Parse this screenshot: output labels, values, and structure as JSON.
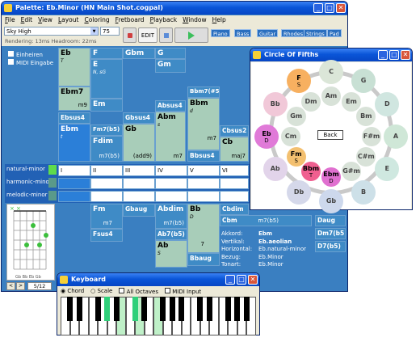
{
  "palette": {
    "title": "Palette: Eb.Minor (HN Main Shot.cogpal)",
    "menu": [
      "File",
      "Edit",
      "View",
      "Layout",
      "Coloring",
      "Fretboard",
      "Playback",
      "Window",
      "Help"
    ],
    "sound": "Sky High",
    "tempo": "75",
    "edit": "EDIT",
    "tabs": [
      "Piano",
      "Bass",
      "Guitar",
      "Rhodes",
      "Strings",
      "Pad"
    ],
    "status": "Rendering: 13ms    Headroom: 22ms",
    "checks": [
      "Einheiren",
      "MIDI Eingabe"
    ],
    "chords": [
      {
        "name": "Eb",
        "sub": "T",
        "cls": "gl"
      },
      {
        "name": "F",
        "sub": "",
        "cls": "gm"
      },
      {
        "name": "Gbm",
        "sub": "",
        "cls": "gm"
      },
      {
        "name": "G",
        "sub": "",
        "cls": "gm"
      },
      {
        "name": "E",
        "sub": "N, sG",
        "cls": "gm"
      },
      {
        "name": "Gm",
        "sub": "",
        "cls": "gm"
      },
      {
        "name": "Ebm7",
        "sub": "",
        "extra": "m9",
        "cls": "gl"
      },
      {
        "name": "Em",
        "sub": "",
        "cls": "gm"
      },
      {
        "name": "Bbm7(#5)",
        "sub": "",
        "cls": "gm"
      },
      {
        "name": "Bbm",
        "sub": "d",
        "extra": "m7",
        "cls": "gl"
      },
      {
        "name": "Absus4",
        "sub": "",
        "cls": "gm"
      },
      {
        "name": "Abm",
        "sub": "s",
        "extra": "m7",
        "cls": "gl"
      },
      {
        "name": "Ebsus4",
        "sub": "",
        "cls": "gm"
      },
      {
        "name": "Ebm",
        "sub": "t",
        "cls": "blue"
      },
      {
        "name": "Fm7(b5)",
        "sub": "",
        "cls": "gm"
      },
      {
        "name": "Fdim",
        "sub": "",
        "extra": "m7(b5)",
        "cls": "gm"
      },
      {
        "name": "Gbsus4",
        "sub": "",
        "cls": "gm"
      },
      {
        "name": "Gb",
        "sub": "",
        "extra": "(add9)",
        "cls": "gl"
      },
      {
        "name": "Bbsus4",
        "sub": "",
        "cls": "gm"
      },
      {
        "name": "Cbsus2",
        "sub": "",
        "cls": "gm"
      },
      {
        "name": "Cb",
        "sub": "",
        "extra": "maj7",
        "cls": "gl"
      }
    ],
    "scale_labels": [
      "natural-minor",
      "harmonic-minor",
      "melodic-minor"
    ],
    "degrees": [
      "I",
      "II",
      "III",
      "IV",
      "V",
      "VI"
    ],
    "lower": [
      {
        "name": "Fm",
        "extra": "m7",
        "cls": "gm"
      },
      {
        "name": "Fsus4",
        "cls": "gm"
      },
      {
        "name": "Gbaug",
        "cls": "gm"
      },
      {
        "name": "Abdim",
        "extra": "m7(b5)",
        "cls": "gm"
      },
      {
        "name": "Ab7(b5)",
        "cls": "gm"
      },
      {
        "name": "Ab",
        "sub": "S",
        "cls": "gl"
      },
      {
        "name": "Bb",
        "sub": "D",
        "extra": "7",
        "cls": "gl"
      },
      {
        "name": "Bbaug",
        "cls": "gm"
      },
      {
        "name": "Cbdim",
        "cls": "gm"
      },
      {
        "name": "Cbm",
        "extra": "m7(b5)",
        "cls": "gm"
      },
      {
        "name": "Daug",
        "cls": "gm"
      },
      {
        "name": "Dm7(b5)",
        "cls": "gm"
      },
      {
        "name": "D7(b5)",
        "cls": "gm"
      }
    ],
    "info": [
      {
        "k": "Akkord:",
        "v": "Ebm"
      },
      {
        "k": "Vertikal:",
        "v": "Eb.aeolian"
      },
      {
        "k": "Horizontal:",
        "v": "Eb.natural-minor"
      },
      {
        "k": "Bezug:",
        "v": "Eb.Minor"
      },
      {
        "k": "Tonart:",
        "v": "Eb.Minor"
      }
    ],
    "fret_label": "Gb Bb Eb Gb",
    "page": "5/12"
  },
  "circle": {
    "title": "Circle Of Fifths",
    "back": "Back",
    "outer": [
      {
        "n": "C",
        "s": ""
      },
      {
        "n": "G",
        "s": ""
      },
      {
        "n": "D",
        "s": ""
      },
      {
        "n": "A",
        "s": ""
      },
      {
        "n": "E",
        "s": ""
      },
      {
        "n": "B",
        "s": ""
      },
      {
        "n": "Gb",
        "s": ""
      },
      {
        "n": "Db",
        "s": ""
      },
      {
        "n": "Ab",
        "s": ""
      },
      {
        "n": "Eb",
        "s": "D"
      },
      {
        "n": "Bb",
        "s": ""
      },
      {
        "n": "F",
        "s": "S"
      }
    ],
    "inner": [
      {
        "n": "Am",
        "s": ""
      },
      {
        "n": "Em",
        "s": ""
      },
      {
        "n": "Bm",
        "s": ""
      },
      {
        "n": "F#m",
        "s": ""
      },
      {
        "n": "C#m",
        "s": ""
      },
      {
        "n": "G#m",
        "s": ""
      },
      {
        "n": "Ebm",
        "s": "D"
      },
      {
        "n": "Bbm",
        "s": "T"
      },
      {
        "n": "Fm",
        "s": "S"
      },
      {
        "n": "Cm",
        "s": ""
      },
      {
        "n": "Gm",
        "s": ""
      },
      {
        "n": "Dm",
        "s": ""
      }
    ]
  },
  "keyboard": {
    "title": "Keyboard",
    "opts": [
      "Chord",
      "Scale",
      "All Octaves",
      "MIDI Input"
    ]
  },
  "colors": {
    "accent": "#2b7fd8",
    "panel": "#3f8bc6",
    "highlight": "#7fe0a0"
  }
}
